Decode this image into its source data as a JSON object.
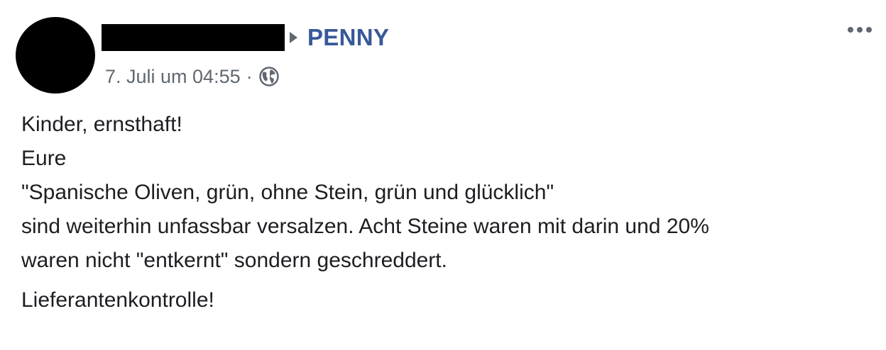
{
  "post": {
    "page_name": "PENNY",
    "timestamp": "7. Juli um 04:55",
    "separator": "·",
    "privacy_icon": "globe-icon",
    "more_icon": "more-options-icon",
    "body_lines": [
      "Kinder, ernsthaft!",
      "Eure",
      "\"Spanische Oliven, grün, ohne Stein, grün und glücklich\"",
      "sind weiterhin unfassbar versalzen. Acht Steine waren mit darin und 20%",
      "waren nicht \"entkernt\" sondern geschreddert."
    ],
    "body_last": "Lieferantenkontrolle!"
  },
  "colors": {
    "link": "#385898",
    "meta": "#606770",
    "text": "#1c1e21",
    "redaction": "#000000"
  }
}
